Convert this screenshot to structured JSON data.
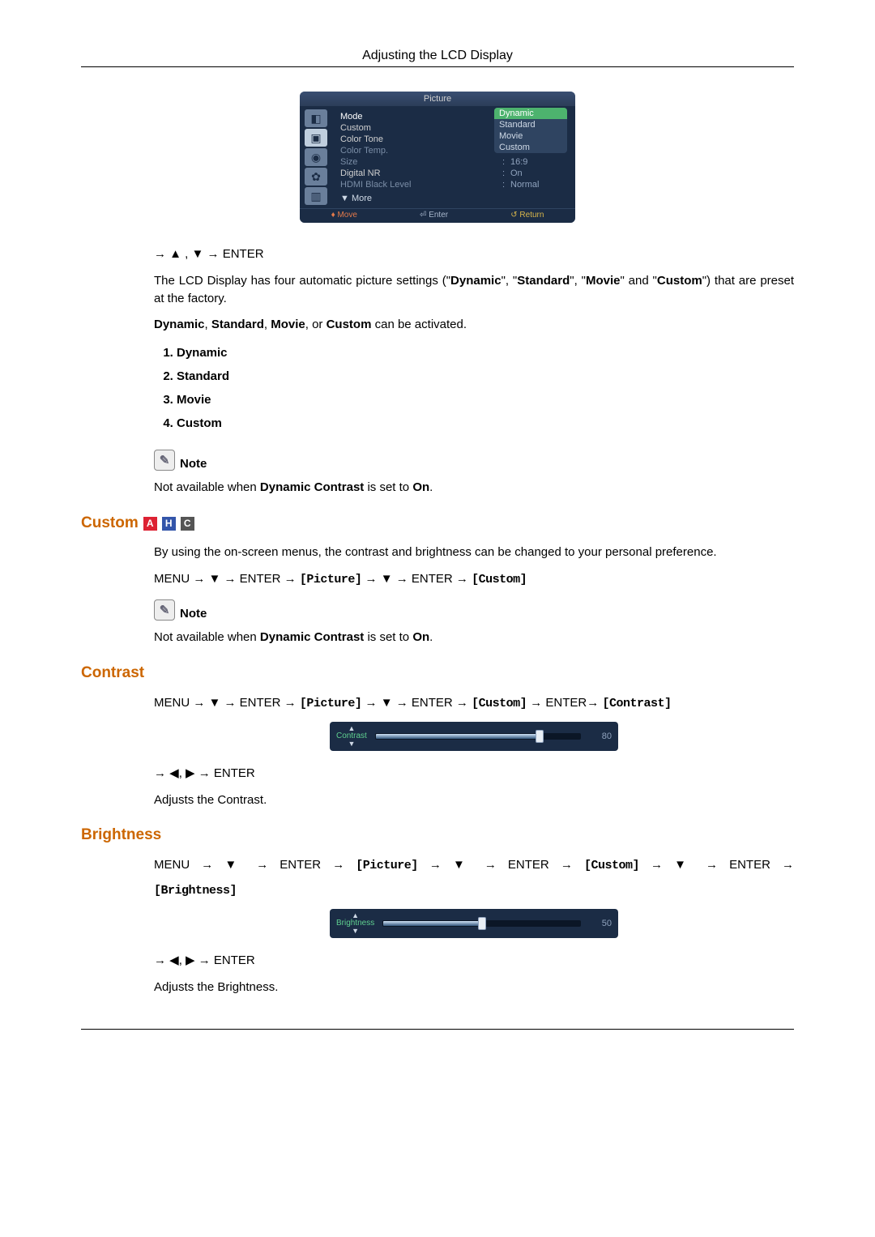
{
  "header": {
    "title": "Adjusting the LCD Display"
  },
  "osd": {
    "title": "Picture",
    "rows": [
      {
        "label": "Mode",
        "value": "",
        "dim": false,
        "highlight": true
      },
      {
        "label": "Custom",
        "value": "",
        "dim": false
      },
      {
        "label": "Color Tone",
        "value": "",
        "dim": false
      },
      {
        "label": "Color Temp.",
        "value": "",
        "dim": true
      },
      {
        "label": "Size",
        "value": "16:9",
        "dim": true
      },
      {
        "label": "Digital NR",
        "value": "On",
        "dim": false
      },
      {
        "label": "HDMI Black Level",
        "value": "Normal",
        "dim": true
      }
    ],
    "more_label": "More",
    "dropdown": {
      "items": [
        "Dynamic",
        "Standard",
        "Movie",
        "Custom"
      ],
      "selected_index": 0
    },
    "footer": {
      "move": "Move",
      "enter": "Enter",
      "return": "Return"
    }
  },
  "nav1": "→ ▲ , ▼ → ENTER",
  "desc1": {
    "prefix": "The LCD Display has four automatic picture settings (\"",
    "q1": "Dynamic",
    "mid1": "\", \"",
    "q2": "Standard",
    "mid2": "\", \"",
    "q3": "Movie",
    "mid3": "\" and \"",
    "q4": "Custom",
    "suffix": "\") that are preset at the factory."
  },
  "desc2": {
    "b1": "Dynamic",
    "s1": ", ",
    "b2": "Standard",
    "s2": ", ",
    "b3": "Movie",
    "s3": ", or ",
    "b4": "Custom",
    "suffix": " can be activated."
  },
  "list": {
    "i1": "Dynamic",
    "i2": "Standard",
    "i3": "Movie",
    "i4": "Custom"
  },
  "note_label": "Note",
  "note1": {
    "prefix": "Not available when ",
    "b": "Dynamic Contrast",
    "mid": " is set to ",
    "on": "On",
    "suffix": "."
  },
  "custom": {
    "heading": "Custom",
    "badges": {
      "a": "A",
      "h": "H",
      "c": "C"
    },
    "desc": "By using the on-screen menus, the contrast and brightness can be changed to your personal preference.",
    "path": {
      "p1": "MENU → ▼ → ENTER → ",
      "t1": "[Picture]",
      "p2": " → ▼ → ENTER → ",
      "t2": "[Custom]"
    },
    "note": {
      "prefix": "Not available when ",
      "b": "Dynamic Contrast",
      "mid": " is set to ",
      "on": "On",
      "suffix": "."
    }
  },
  "contrast": {
    "heading": "Contrast",
    "path": {
      "p1": "MENU → ▼ → ENTER → ",
      "t1": "[Picture]",
      "p2": " → ▼ → ENTER → ",
      "t2": "[Custom]",
      "p3": " → ENTER→ ",
      "t3": "[Contrast]"
    },
    "slider": {
      "label": "Contrast",
      "value": "80",
      "percent": 80
    },
    "nav": "→ ◀, ▶ → ENTER",
    "desc": "Adjusts the Contrast."
  },
  "brightness": {
    "heading": "Brightness",
    "path": {
      "p1": "MENU → ▼ → ENTER → ",
      "t1": "[Picture]",
      "p2": " → ▼ → ENTER → ",
      "t2": "[Custom]",
      "p3": " → ▼ → ENTER → ",
      "t3": "[Brightness]"
    },
    "slider": {
      "label": "Brightness",
      "value": "50",
      "percent": 50
    },
    "nav": "→ ◀, ▶ → ENTER",
    "desc": "Adjusts the Brightness."
  }
}
